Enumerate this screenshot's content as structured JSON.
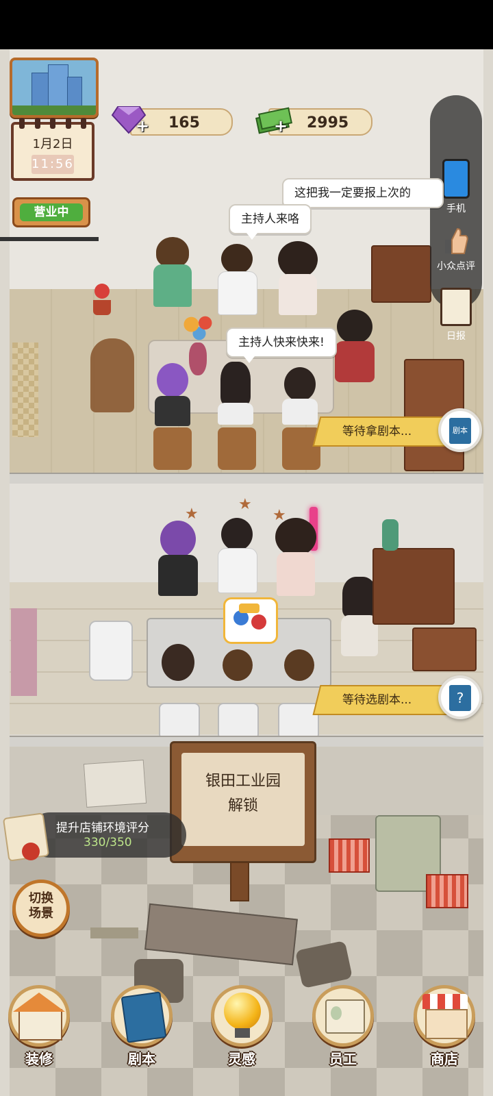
{
  "resources": {
    "gems": {
      "value": "165",
      "plus": "+",
      "color": "#9b59c4"
    },
    "cash": {
      "value": "2995",
      "plus": "+",
      "color": "#4f9e3a"
    }
  },
  "calendar": {
    "date": "1月2日",
    "time_h": "11",
    "time_m": "56"
  },
  "shop_status": "营业中",
  "side_menu": [
    {
      "label": "手机",
      "icon": "phone-icon"
    },
    {
      "label": "小众点评",
      "icon": "review-thumbs-up-icon"
    },
    {
      "label": "日报",
      "icon": "daily-report-clipboard-icon"
    }
  ],
  "room1": {
    "bubbles": [
      "这把我一定要报上次的",
      "主持人来咯",
      "主持人快来快来!"
    ],
    "status": "等待拿剧本...",
    "status_badge": "剧本"
  },
  "room2": {
    "status": "等待选剧本...",
    "status_badge": "?"
  },
  "locked_area": {
    "name": "银田工业园",
    "action": "解锁"
  },
  "upgrade": {
    "label": "提升店铺环境评分",
    "value": "330/350"
  },
  "switch_scene": {
    "line1": "切换",
    "line2": "场景"
  },
  "bottom_nav": [
    {
      "label": "装修",
      "icon": "house-decorate-icon"
    },
    {
      "label": "剧本",
      "icon": "script-book-icon"
    },
    {
      "label": "灵感",
      "icon": "inspiration-bulb-icon"
    },
    {
      "label": "员工",
      "icon": "staff-badge-icon"
    },
    {
      "label": "商店",
      "icon": "shop-store-icon"
    }
  ]
}
